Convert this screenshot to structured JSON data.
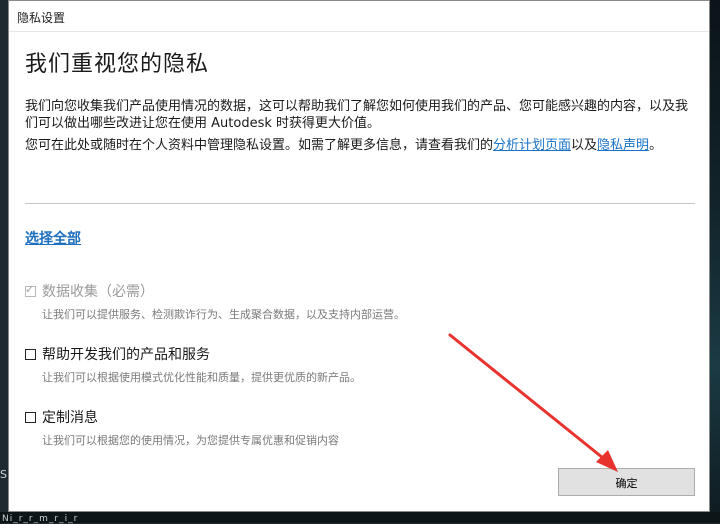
{
  "window": {
    "title": "隐私设置"
  },
  "heading": "我们重视您的隐私",
  "intro": {
    "p1": "我们向您收集我们产品使用情况的数据，这可以帮助我们了解您如何使用我们的产品、您可能感兴趣的内容，以及我们可以做出哪些改进让您在使用 Autodesk 时获得更大价值。",
    "p2_before": "您可在此处或随时在个人资料中管理隐私设置。如需了解更多信息，请查看我们的",
    "p2_link1": "分析计划页面",
    "p2_between": "以及",
    "p2_link2": "隐私声明",
    "p2_after": "。"
  },
  "select_all": "选择全部",
  "options": [
    {
      "label": "数据收集（必需）",
      "desc": "让我们可以提供服务、检测欺诈行为、生成聚合数据，以及支持内部运营。",
      "checked": true,
      "disabled": true
    },
    {
      "label": "帮助开发我们的产品和服务",
      "desc": "让我们可以根据使用模式优化性能和质量，提供更优质的新产品。",
      "checked": false,
      "disabled": false
    },
    {
      "label": "定制消息",
      "desc": "让我们可以根据您的使用情况，为您提供专属优惠和促销内容",
      "checked": false,
      "disabled": false
    }
  ],
  "ok_button": "确定",
  "backdrop": {
    "left_text": "S",
    "bottom_text": "Ni_r_r_m_r_i_r"
  },
  "colors": {
    "link": "#1a73c8",
    "annotation_arrow": "#e8322d"
  }
}
